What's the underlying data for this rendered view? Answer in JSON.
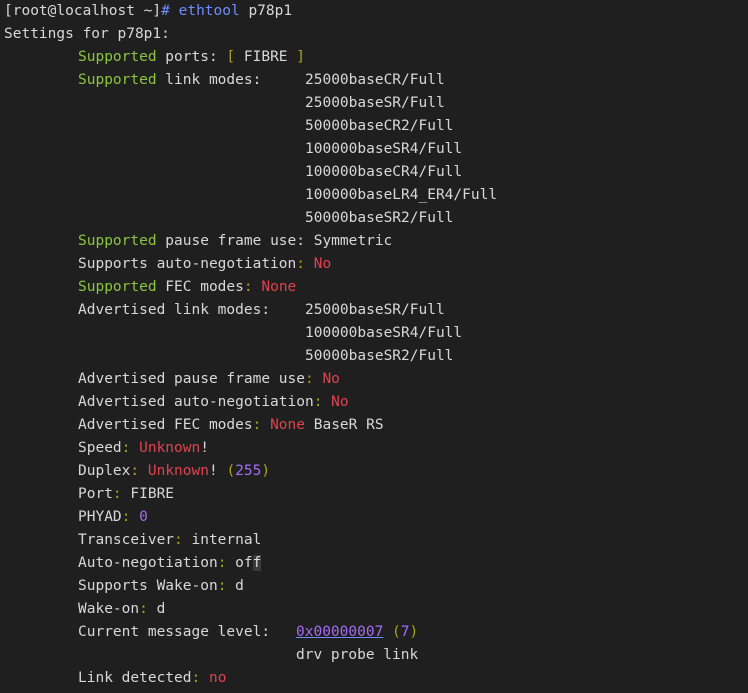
{
  "prompt": {
    "user_host": "[root@localhost ~]",
    "sym": "#",
    "cmd": "ethtool",
    "arg": "p78p1"
  },
  "settings_header": "Settings for p78p1:",
  "supported_ports": {
    "w1": "Supported",
    "w2": " ports:",
    "lb": "[",
    "val": " FIBRE ",
    "rb": "]"
  },
  "supported_link_modes": {
    "w1": "Supported",
    "w2": " link modes:",
    "modes": [
      "25000baseCR/Full",
      "25000baseSR/Full",
      "50000baseCR2/Full",
      "100000baseSR4/Full",
      "100000baseCR4/Full",
      "100000baseLR4_ER4/Full",
      "50000baseSR2/Full"
    ]
  },
  "pause_frame": {
    "w1": "Supported",
    "w2": " pause frame use:",
    "val": " Symmetric"
  },
  "auto_neg": {
    "label": "Supports auto-negotiation",
    "colon": ":",
    "val": " No"
  },
  "fec_modes": {
    "w1": "Supported",
    "w2": " FEC modes",
    "colon": ":",
    "val": " None"
  },
  "advertised_link_modes": {
    "label": "Advertised link modes:",
    "modes": [
      "25000baseSR/Full",
      "100000baseSR4/Full",
      "50000baseSR2/Full"
    ]
  },
  "adv_pause": {
    "label": "Advertised pause frame use",
    "colon": ":",
    "val": " No"
  },
  "adv_autoneg": {
    "label": "Advertised auto-negotiation",
    "colon": ":",
    "val": " No"
  },
  "adv_fec": {
    "label": "Advertised FEC modes",
    "colon": ":",
    "val1": " None",
    "val2": " BaseR RS"
  },
  "speed": {
    "label": "Speed",
    "colon": ":",
    "val": " Unknown",
    "bang": "!"
  },
  "duplex": {
    "label": "Duplex",
    "colon": ":",
    "val": " Unknown",
    "bang": "! ",
    "lp": "(",
    "num": "255",
    "rp": ")"
  },
  "port": {
    "label": "Port",
    "colon": ":",
    "val": " FIBRE"
  },
  "phyad": {
    "label": "PHYAD",
    "colon": ":",
    "val": "0"
  },
  "transceiver": {
    "label": "Transceiver",
    "colon": ":",
    "val": " internal"
  },
  "autoneg": {
    "label": "Auto-negotiation",
    "colon": ":",
    "val1": " of",
    "val2": "f"
  },
  "wake_support": {
    "label": "Supports Wake-on",
    "colon": ":",
    "val": " d"
  },
  "wake_on": {
    "label": "Wake-on",
    "colon": ":",
    "val": " d"
  },
  "msg_level": {
    "label": "Current message level:",
    "hex": "0x00000007",
    "lp": " (",
    "num": "7",
    "rp": ")",
    "flags": "drv probe link"
  },
  "link_detected": {
    "label": "Link detected",
    "colon": ":",
    "val": " no"
  }
}
